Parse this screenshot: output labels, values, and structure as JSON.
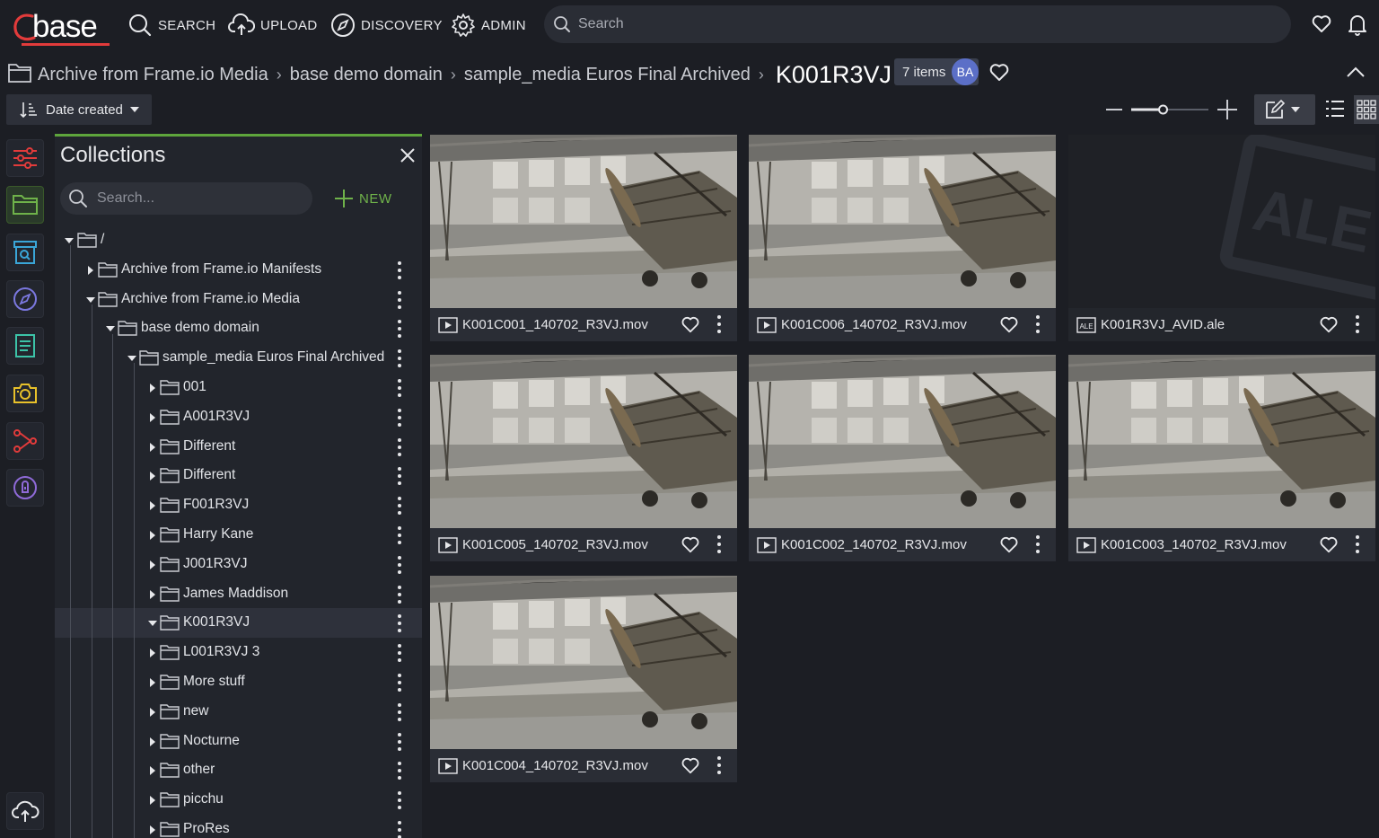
{
  "app": {
    "logo_text": "base",
    "accent": "#e23b3b"
  },
  "nav": [
    {
      "label": "SEARCH",
      "icon": "search-icon"
    },
    {
      "label": "UPLOAD",
      "icon": "cloud-upload-icon"
    },
    {
      "label": "DISCOVERY",
      "icon": "compass-icon"
    },
    {
      "label": "ADMIN",
      "icon": "gear-icon"
    }
  ],
  "search": {
    "placeholder": "Search"
  },
  "breadcrumb": {
    "items": [
      "Archive from Frame.io Media",
      "base demo domain",
      "sample_media Euros Final Archived"
    ],
    "current": "K001R3VJ",
    "items_badge": "7 items",
    "avatar_initials": "BA"
  },
  "toolbar": {
    "sort_label": "Date created",
    "zoom_level": 0.25
  },
  "collections": {
    "title": "Collections",
    "search_placeholder": "Search...",
    "new_label": "NEW",
    "root_label": "/",
    "tree": [
      {
        "label": "Archive from Frame.io Manifests",
        "depth": 1,
        "expanded": false
      },
      {
        "label": "Archive from Frame.io Media",
        "depth": 1,
        "expanded": true
      },
      {
        "label": "base demo domain",
        "depth": 2,
        "expanded": true
      },
      {
        "label": "sample_media Euros Final Archived",
        "depth": 3,
        "expanded": true
      },
      {
        "label": "001",
        "depth": 4,
        "expanded": false
      },
      {
        "label": "A001R3VJ",
        "depth": 4,
        "expanded": false
      },
      {
        "label": "Different",
        "depth": 4,
        "expanded": false
      },
      {
        "label": "Different",
        "depth": 4,
        "expanded": false
      },
      {
        "label": "F001R3VJ",
        "depth": 4,
        "expanded": false
      },
      {
        "label": "Harry Kane",
        "depth": 4,
        "expanded": false
      },
      {
        "label": "J001R3VJ",
        "depth": 4,
        "expanded": false
      },
      {
        "label": "James Maddison",
        "depth": 4,
        "expanded": false
      },
      {
        "label": "K001R3VJ",
        "depth": 4,
        "expanded": true,
        "selected": true
      },
      {
        "label": "L001R3VJ 3",
        "depth": 4,
        "expanded": false
      },
      {
        "label": "More stuff",
        "depth": 4,
        "expanded": false
      },
      {
        "label": "new",
        "depth": 4,
        "expanded": false
      },
      {
        "label": "Nocturne",
        "depth": 4,
        "expanded": false
      },
      {
        "label": "other",
        "depth": 4,
        "expanded": false
      },
      {
        "label": "picchu",
        "depth": 4,
        "expanded": false
      },
      {
        "label": "ProRes",
        "depth": 4,
        "expanded": false
      }
    ]
  },
  "assets": [
    {
      "name": "K001C001_140702_R3VJ.mov",
      "type": "video"
    },
    {
      "name": "K001C006_140702_R3VJ.mov",
      "type": "video"
    },
    {
      "name": "K001R3VJ_AVID.ale",
      "type": "ale",
      "thumb_text": "ALE"
    },
    {
      "name": "K001C005_140702_R3VJ.mov",
      "type": "video"
    },
    {
      "name": "K001C002_140702_R3VJ.mov",
      "type": "video"
    },
    {
      "name": "K001C003_140702_R3VJ.mov",
      "type": "video"
    },
    {
      "name": "K001C004_140702_R3VJ.mov",
      "type": "video"
    }
  ],
  "icons": {
    "ale_badge": "ALE"
  }
}
